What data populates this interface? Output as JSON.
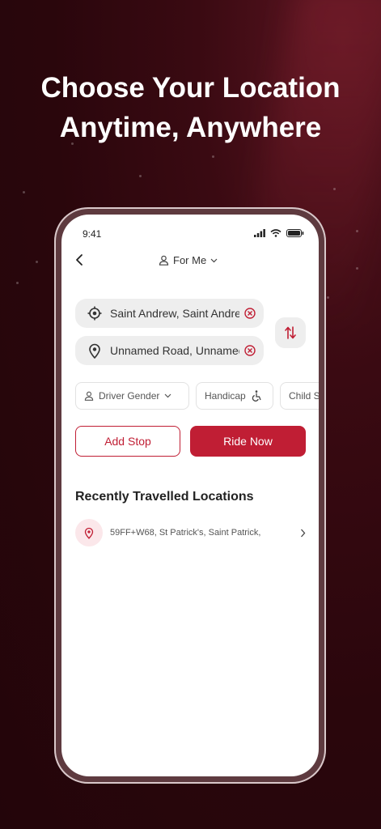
{
  "headline": {
    "line1": "Choose Your Location",
    "line2": "Anytime, Anywhere"
  },
  "status": {
    "time": "9:41"
  },
  "header": {
    "rider_label": "For Me"
  },
  "locations": {
    "pickup": "Saint Andrew, Saint Andrew",
    "dropoff": "Unnamed Road, Unnamed"
  },
  "filters": [
    {
      "label": "Driver Gender"
    },
    {
      "label": "Handicap"
    },
    {
      "label": "Child Seat"
    }
  ],
  "actions": {
    "add_stop": "Add Stop",
    "ride_now": "Ride Now"
  },
  "recent": {
    "title": "Recently Travelled Locations",
    "items": [
      {
        "address": "59FF+W68, St Patrick's, Saint Patrick,"
      }
    ]
  },
  "colors": {
    "accent": "#c01e34",
    "background": "#2a060c"
  }
}
